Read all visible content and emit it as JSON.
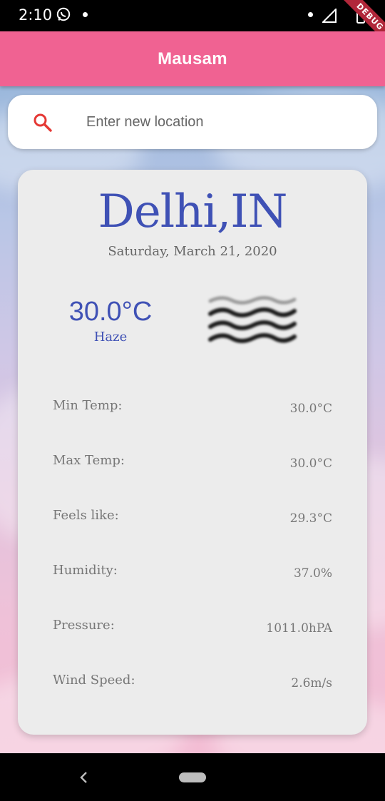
{
  "status_bar": {
    "time": "2:10",
    "debug_label": "DEBUG"
  },
  "app_bar": {
    "title": "Mausam",
    "color": "#f06292"
  },
  "search": {
    "placeholder": "Enter new location",
    "value": "",
    "icon": "search-icon",
    "icon_color": "#e53935"
  },
  "weather": {
    "city": "Delhi,IN",
    "date": "Saturday, March 21, 2020",
    "temperature": "30.0°C",
    "condition": "Haze",
    "condition_icon": "haze-icon",
    "accent_color": "#3f51b5"
  },
  "details": [
    {
      "label": "Min Temp:",
      "value": "30.0°C"
    },
    {
      "label": "Max Temp:",
      "value": "30.0°C"
    },
    {
      "label": "Feels like:",
      "value": "29.3°C"
    },
    {
      "label": "Humidity:",
      "value": "37.0%"
    },
    {
      "label": "Pressure:",
      "value": "1011.0hPA"
    },
    {
      "label": "Wind Speed:",
      "value": "2.6m/s"
    }
  ],
  "nav_bar": {
    "back_icon": "back-chevron-icon",
    "home_icon": "home-pill-icon"
  }
}
